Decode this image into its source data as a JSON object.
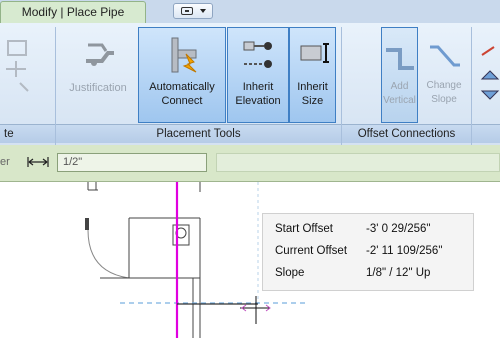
{
  "tabs": {
    "active_label": "Modify | Place Pipe"
  },
  "ribbon": {
    "buttons": [
      {
        "label": "Justification"
      },
      {
        "label": "Automatically Connect"
      },
      {
        "label": "Inherit Elevation"
      },
      {
        "label": "Inherit Size"
      },
      {
        "label": "Add Vertical"
      },
      {
        "label": "Change Slope"
      }
    ],
    "groups": [
      {
        "label": "te"
      },
      {
        "label": "Placement Tools"
      },
      {
        "label": "Offset Connections"
      }
    ]
  },
  "options_bar": {
    "label": "er",
    "field_value": "1/2\""
  },
  "tooltip": {
    "rows": [
      {
        "key": "Start Offset",
        "value": "-3'  0 29/256\""
      },
      {
        "key": "Current Offset",
        "value": "-2'  11 109/256\""
      },
      {
        "key": "Slope",
        "value": "1/8\" / 12\" Up"
      }
    ]
  },
  "colors": {
    "ribbon_bg": "#d4e2f2",
    "tab_active": "#d7ead0",
    "options_bar": "#d8e7c9",
    "pipe_magenta": "#e000e0",
    "pressed_button": "#9fc6ef"
  }
}
